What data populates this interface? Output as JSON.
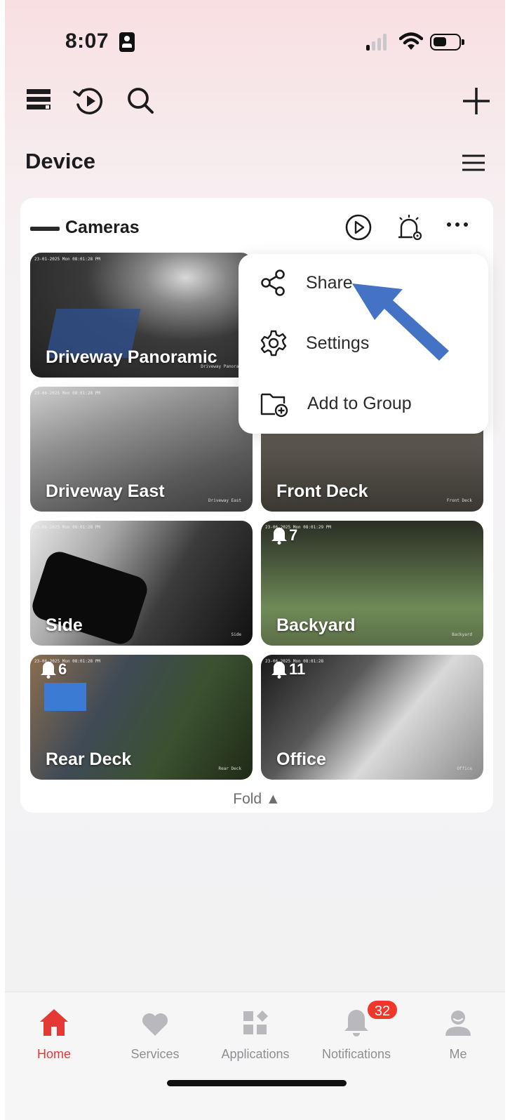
{
  "status_bar": {
    "time": "8:07"
  },
  "header": {
    "section_title": "Device"
  },
  "card": {
    "title": "Cameras",
    "fold_label": "Fold ▲",
    "cameras": [
      {
        "name": "Driveway Panoramic",
        "timestamp": "23-01-2025 Mon 08:01:28 PM",
        "watermark": "Driveway Panoram"
      },
      {
        "name": "Driveway East",
        "timestamp": "23-06-2025 Mon 08:01:28 PM",
        "watermark": "Driveway East"
      },
      {
        "name": "Front Deck",
        "timestamp": "",
        "watermark": "Front Deck"
      },
      {
        "name": "Side",
        "timestamp": "23-06-2025 Mon 08:01:28 PM",
        "watermark": "Side"
      },
      {
        "name": "Backyard",
        "timestamp": "23-06-2025 Mon 08:01:29 PM",
        "watermark": "Backyard",
        "alerts": "7"
      },
      {
        "name": "Rear Deck",
        "timestamp": "23-06-2025 Mon 08:01:28 PM",
        "watermark": "Rear Deck",
        "alerts": "6"
      },
      {
        "name": "Office",
        "timestamp": "23-06-2025 Mon 08:01:28",
        "watermark": "Office",
        "alerts": "11"
      }
    ]
  },
  "popup_menu": {
    "items": [
      {
        "label": "Share",
        "icon": "share-icon"
      },
      {
        "label": "Settings",
        "icon": "gear-icon"
      },
      {
        "label": "Add to Group",
        "icon": "folder-add-icon"
      }
    ]
  },
  "tab_bar": {
    "tabs": [
      {
        "label": "Home",
        "icon": "home-icon",
        "active": true
      },
      {
        "label": "Services",
        "icon": "heart-icon"
      },
      {
        "label": "Applications",
        "icon": "apps-icon"
      },
      {
        "label": "Notifications",
        "icon": "bell-icon",
        "badge": "32"
      },
      {
        "label": "Me",
        "icon": "user-icon"
      }
    ]
  },
  "colors": {
    "accent": "#e53935",
    "badge": "#f0372a",
    "annotation_arrow": "#4472c4"
  }
}
